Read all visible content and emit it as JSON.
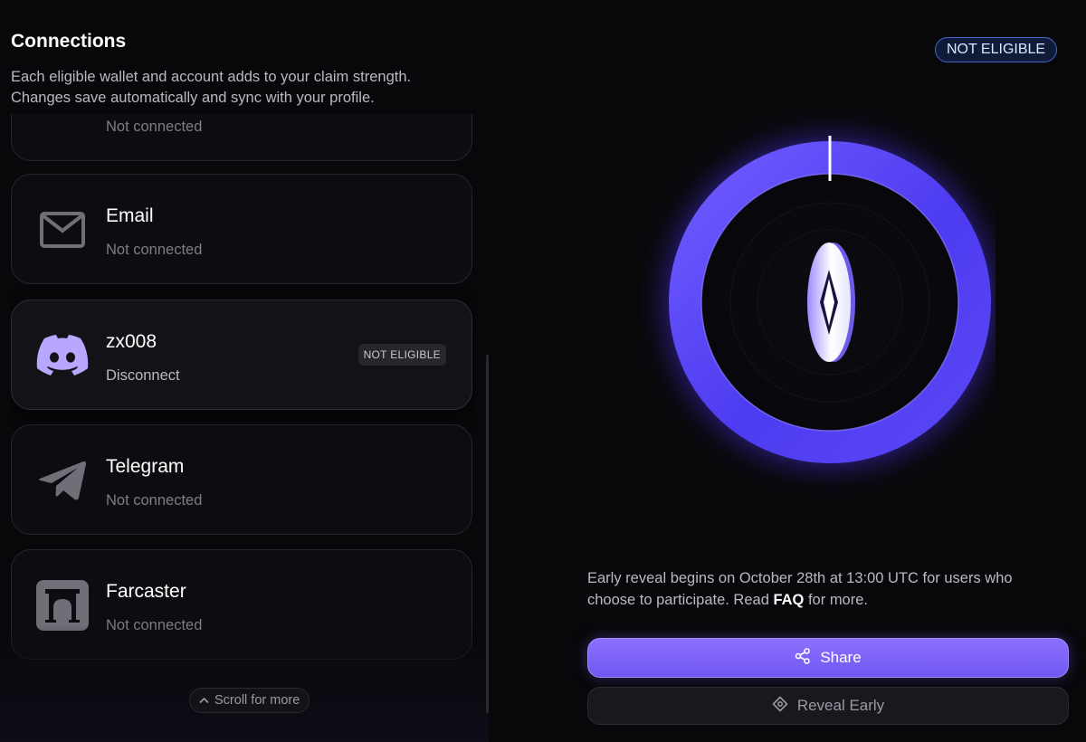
{
  "header": {
    "title": "Connections",
    "description_line1": "Each eligible wallet and account adds to your claim strength.",
    "description_line2": "Changes save automatically and sync with your profile."
  },
  "connections": [
    {
      "name": "",
      "status": "Not connected",
      "icon": "partial-hidden"
    },
    {
      "name": "Email",
      "status": "Not connected",
      "icon": "envelope-icon"
    },
    {
      "name": "zx008",
      "status": "Disconnect",
      "badge": "NOT ELIGIBLE",
      "icon": "discord-icon"
    },
    {
      "name": "Telegram",
      "status": "Not connected",
      "icon": "telegram-icon"
    },
    {
      "name": "Farcaster",
      "status": "Not connected",
      "icon": "farcaster-icon"
    }
  ],
  "scroll_hint": "Scroll for more",
  "eligibility_pill": "NOT ELIGIBLE",
  "info": {
    "text_before": "Early reveal begins on October 28th at 13:00 UTC for users who choose to participate. Read ",
    "link": "FAQ",
    "text_after": " for more."
  },
  "buttons": {
    "share": "Share",
    "reveal": "Reveal Early"
  },
  "colors": {
    "accent": "#7c63ff",
    "ring": "#5a3df5",
    "discord": "#b9a6ff",
    "pill_border": "#3f69c7"
  }
}
